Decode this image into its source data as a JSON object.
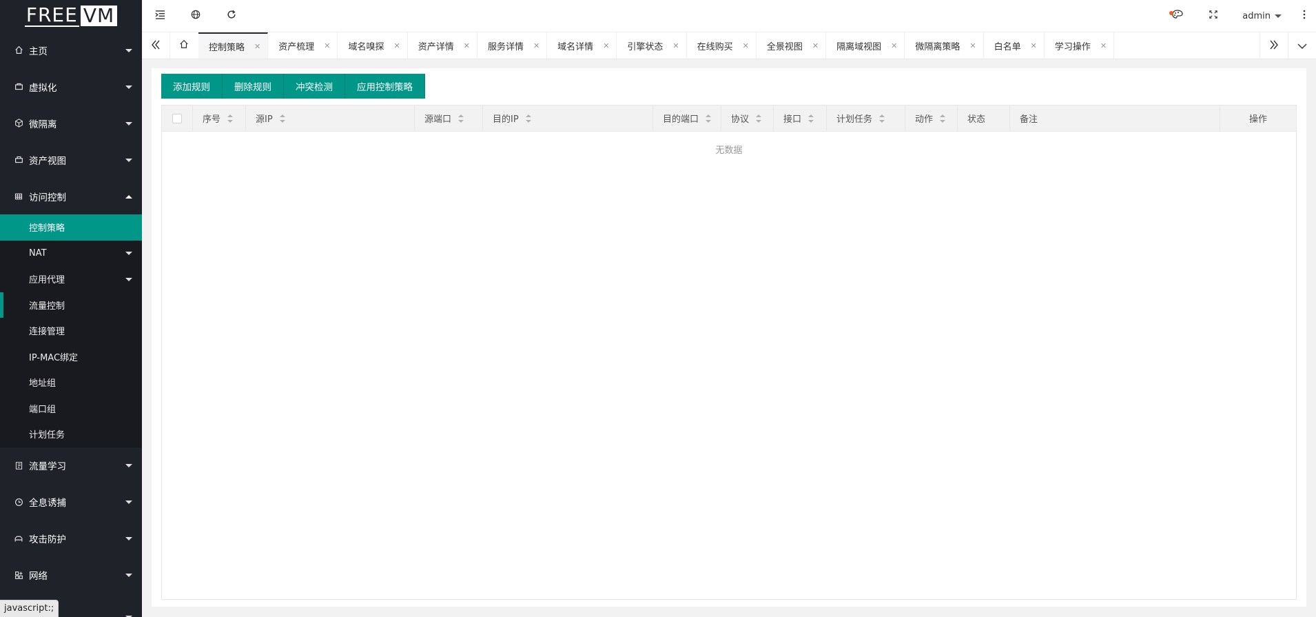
{
  "logo": {
    "part1": "FREE",
    "part2": "VM"
  },
  "sidebar": {
    "items": [
      {
        "label": "主页",
        "icon": "home-icon"
      },
      {
        "label": "虚拟化",
        "icon": "server-icon"
      },
      {
        "label": "微隔离",
        "icon": "cube-icon"
      },
      {
        "label": "资产视图",
        "icon": "asset-icon"
      },
      {
        "label": "访问控制",
        "icon": "grid-icon"
      }
    ],
    "sub": [
      {
        "label": "控制策略"
      },
      {
        "label": "NAT"
      },
      {
        "label": "应用代理"
      },
      {
        "label": "流量控制"
      },
      {
        "label": "连接管理"
      },
      {
        "label": "IP-MAC绑定"
      },
      {
        "label": "地址组"
      },
      {
        "label": "端口组"
      },
      {
        "label": "计划任务"
      }
    ],
    "items2": [
      {
        "label": "流量学习",
        "icon": "book-icon"
      },
      {
        "label": "全息诱捕",
        "icon": "trap-icon"
      },
      {
        "label": "攻击防护",
        "icon": "shield-icon"
      },
      {
        "label": "网络",
        "icon": "network-icon"
      }
    ]
  },
  "status_url": "javascript:;",
  "header": {
    "user": "admin"
  },
  "tabs": [
    "控制策略",
    "资产梳理",
    "域名嗅探",
    "资产详情",
    "服务详情",
    "域名详情",
    "引擎状态",
    "在线购买",
    "全景视图",
    "隔离域视图",
    "微隔离策略",
    "白名单",
    "学习操作"
  ],
  "toolbar": {
    "add": "添加规则",
    "delete": "删除规则",
    "conflict": "冲突检测",
    "apply": "应用控制策略"
  },
  "table": {
    "columns": [
      "序号",
      "源IP",
      "源端口",
      "目的IP",
      "目的端口",
      "协议",
      "接口",
      "计划任务",
      "动作",
      "状态",
      "备注",
      "操作"
    ],
    "empty": "无数据"
  },
  "colors": {
    "accent": "#009688",
    "sidebar": "#20222a"
  }
}
